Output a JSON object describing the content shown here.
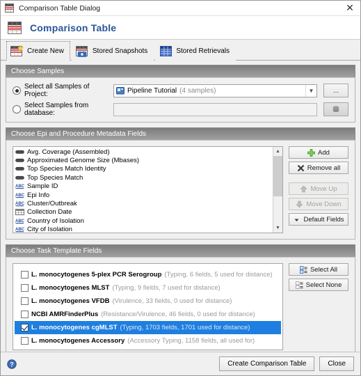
{
  "titlebar": {
    "title": "Comparison Table Dialog",
    "icon": "table-icon",
    "close_label": "✕"
  },
  "banner": {
    "title": "Comparison Table",
    "icon": "comparison-table-icon"
  },
  "tabs": [
    {
      "label": "Create New",
      "icon": "table-new-icon",
      "selected": true
    },
    {
      "label": "Stored Snapshots",
      "icon": "table-camera-icon",
      "selected": false
    },
    {
      "label": "Stored Retrievals",
      "icon": "table-blue-icon",
      "selected": false
    }
  ],
  "choose_samples": {
    "header": "Choose Samples",
    "option_project_label": "Select all Samples of Project:",
    "option_project_selected": true,
    "project_name": "Pipeline Tutorial",
    "project_count": "(4 samples)",
    "project_icon": "project-folder-icon",
    "browse_label": "...",
    "option_database_label": "Select Samples from database:",
    "option_database_selected": false,
    "database_value": "",
    "database_icon": "database-icon"
  },
  "metadata_fields": {
    "header": "Choose Epi and Procedure Metadata Fields",
    "items": [
      {
        "label": "Avg. Coverage (Assembled)",
        "icon": "numeric-field-icon"
      },
      {
        "label": "Approximated Genome Size (Mbases)",
        "icon": "numeric-field-icon"
      },
      {
        "label": "Top Species Match Identity",
        "icon": "numeric-field-icon"
      },
      {
        "label": "Top Species Match",
        "icon": "numeric-field-icon"
      },
      {
        "label": "Sample ID",
        "icon": "text-field-icon"
      },
      {
        "label": "Epi Info",
        "icon": "text-field-icon"
      },
      {
        "label": "Cluster/Outbreak",
        "icon": "text-field-icon"
      },
      {
        "label": "Collection Date",
        "icon": "date-field-icon"
      },
      {
        "label": "Country of Isolation",
        "icon": "text-field-icon"
      },
      {
        "label": "City of Isolation",
        "icon": "text-field-icon"
      }
    ],
    "buttons": [
      {
        "label": "Add",
        "icon": "plus-icon",
        "enabled": true
      },
      {
        "label": "Remove all",
        "icon": "remove-icon",
        "enabled": true
      },
      {
        "label": "Move Up",
        "icon": "arrow-up-icon",
        "enabled": false
      },
      {
        "label": "Move Down",
        "icon": "arrow-down-icon",
        "enabled": false
      },
      {
        "label": "Default Fields",
        "icon": "caret-down-icon",
        "enabled": true
      }
    ]
  },
  "task_templates": {
    "header": "Choose Task Template Fields",
    "rows": [
      {
        "name": "L. monocytogenes 5-plex PCR Serogroup",
        "detail": "(Typing, 6 fields, 5 used for distance)",
        "checked": false,
        "selected": false
      },
      {
        "name": "L. monocytogenes MLST",
        "detail": "(Typing, 9 fields, 7 used for distance)",
        "checked": false,
        "selected": false
      },
      {
        "name": "L. monocytogenes VFDB",
        "detail": "(Virulence, 33 fields, 0 used for distance)",
        "checked": false,
        "selected": false
      },
      {
        "name": "NCBI AMRFinderPlus",
        "detail": "(Resistance/Virulence, 46 fields, 0 used for distance)",
        "checked": false,
        "selected": false
      },
      {
        "name": "L. monocytogenes cgMLST",
        "detail": "(Typing, 1703 fields, 1701 used for distance)",
        "checked": true,
        "selected": true
      },
      {
        "name": "L. monocytogenes Accessory",
        "detail": "(Accessory Typing, 1158 fields, all used for)",
        "checked": false,
        "selected": false
      }
    ],
    "buttons": [
      {
        "label": "Select All",
        "icon": "select-all-icon"
      },
      {
        "label": "Select None",
        "icon": "select-none-icon"
      }
    ]
  },
  "footer": {
    "help_icon": "help-icon",
    "primary_label": "Create Comparison Table",
    "close_label": "Close"
  },
  "colors": {
    "accent": "#2a5699",
    "selection": "#1f7fe0",
    "group_header_text": "#ffffff"
  }
}
